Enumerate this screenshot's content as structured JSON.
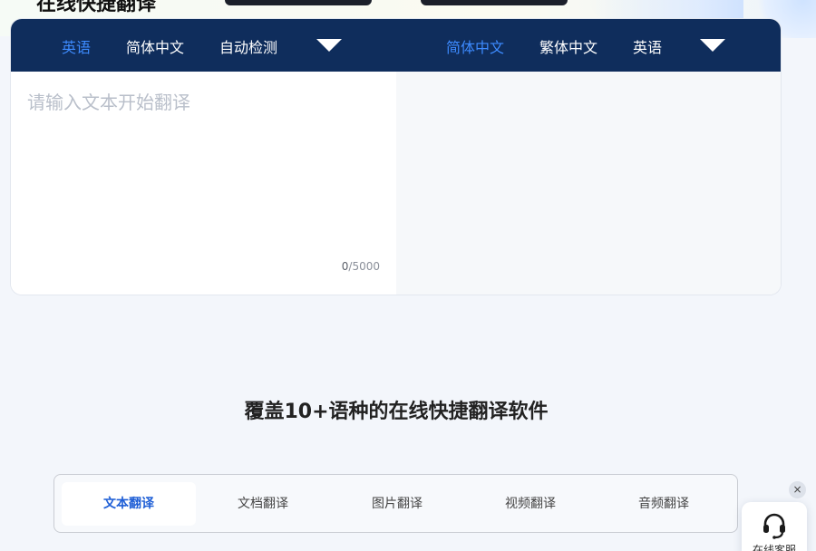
{
  "hero": {
    "title": "在线快捷翻译"
  },
  "translator": {
    "source_langs": [
      "英语",
      "简体中文",
      "自动检测"
    ],
    "source_active": "英语",
    "target_langs": [
      "简体中文",
      "繁体中文",
      "英语"
    ],
    "target_active": "简体中文",
    "input_placeholder": "请输入文本开始翻译",
    "input_value": "",
    "char_count": "0",
    "char_limit": "/5000"
  },
  "section": {
    "title": "覆盖10+语种的在线快捷翻译软件"
  },
  "tabs": [
    {
      "label": "文本翻译",
      "active": true
    },
    {
      "label": "文档翻译",
      "active": false
    },
    {
      "label": "图片翻译",
      "active": false
    },
    {
      "label": "视频翻译",
      "active": false
    },
    {
      "label": "音频翻译",
      "active": false
    }
  ],
  "support": {
    "label": "在线客服",
    "close_glyph": "×",
    "icon": "headset-icon"
  },
  "colors": {
    "bar_bg": "#0f2d5c",
    "accent": "#3d8bff",
    "tab_active": "#1f5fd6"
  }
}
